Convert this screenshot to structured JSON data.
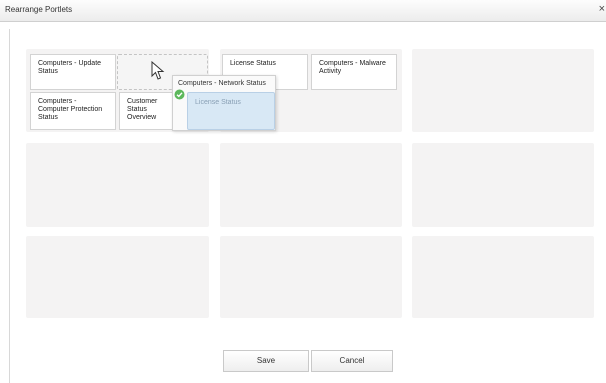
{
  "dialog": {
    "title": "Rearrange Portlets",
    "close_glyph": "×"
  },
  "portlets": [
    {
      "label": "Computers - Update Status"
    },
    {
      "label": "Computers - Computer Protection Status"
    },
    {
      "label": "Customer Status Overview"
    },
    {
      "label": "License Status"
    },
    {
      "label": "Computers - Malware Activity"
    }
  ],
  "drag": {
    "title": "Computers - Network Status",
    "inner_label": "License Status",
    "drop_icon": "check-icon",
    "cursor_icon": "arrow-cursor-icon"
  },
  "buttons": {
    "save": "Save",
    "cancel": "Cancel"
  },
  "colors": {
    "slot": "#f4f3f3",
    "drop_ok": "#5cb85c",
    "ghost_inner": "#d8e8f5"
  }
}
